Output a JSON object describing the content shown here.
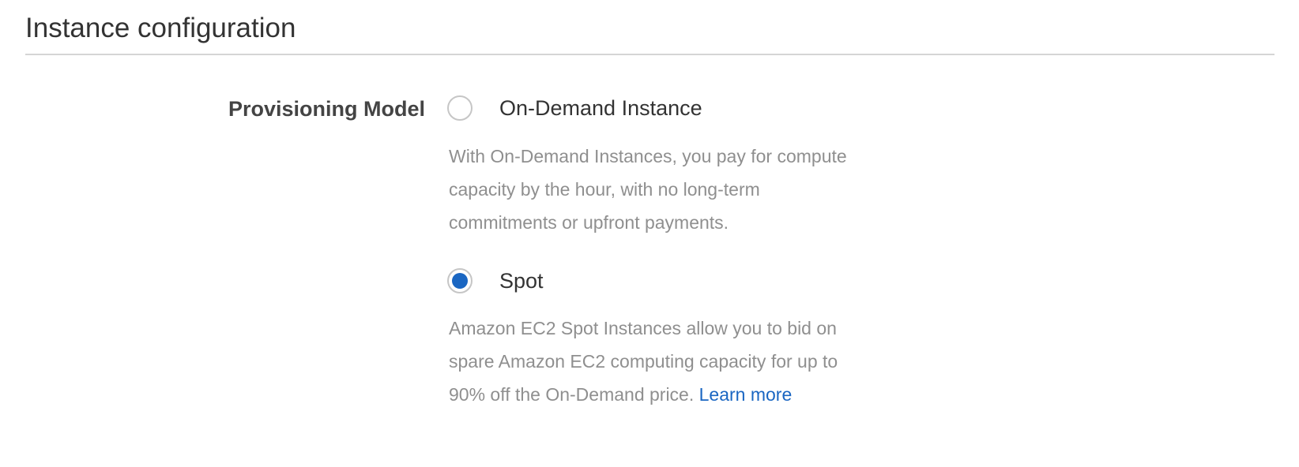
{
  "section": {
    "title": "Instance configuration"
  },
  "provisioning_model": {
    "label": "Provisioning Model",
    "selected": "Spot",
    "options": [
      {
        "label": "On-Demand Instance",
        "checked": false,
        "description": "With On-Demand Instances, you pay for compute capacity by the hour, with no long-term commitments or upfront payments."
      },
      {
        "label": "Spot",
        "checked": true,
        "description": "Amazon EC2 Spot Instances allow you to bid on spare Amazon EC2 computing capacity for up to 90% off the On-Demand price.",
        "link_text": "Learn more"
      }
    ]
  },
  "colors": {
    "accent": "#1a66c2",
    "description_text": "#8f8f8f",
    "divider": "#d5d5d5"
  }
}
